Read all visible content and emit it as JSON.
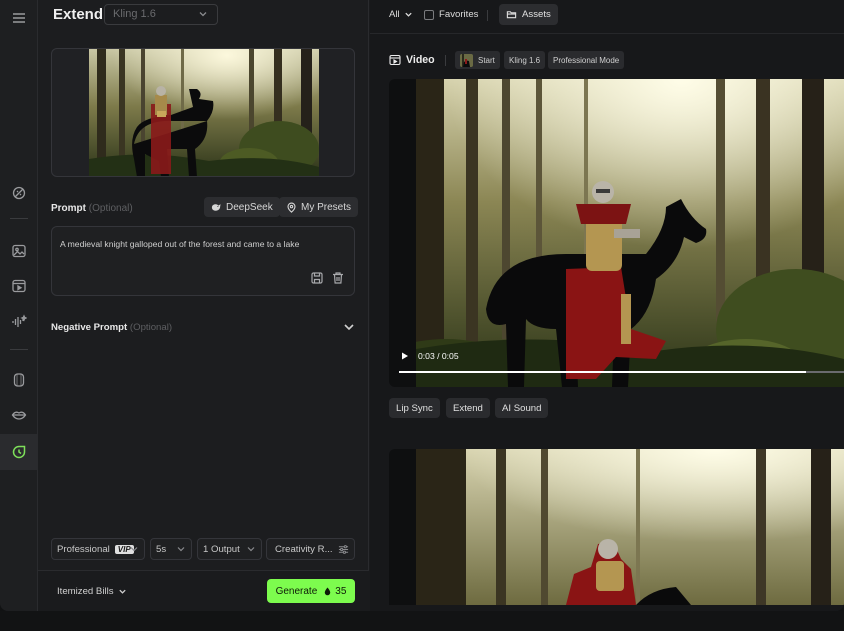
{
  "panel": {
    "title": "Extend",
    "model_placeholder": "Kling 1.6",
    "prompt_label": "Prompt",
    "optional_label": "(Optional)",
    "deepseek_label": "DeepSeek",
    "presets_label": "My Presets",
    "prompt_text": "A medieval knight galloped out of the forest and came to a lake",
    "negative_label": "Negative Prompt",
    "options": {
      "mode": "Professional",
      "mode_badge": "VIP",
      "duration": "5s",
      "outputs": "1 Output",
      "creativity": "Creativity R..."
    },
    "bills_label": "Itemized Bills",
    "generate_label": "Generate",
    "generate_cost": "35"
  },
  "toolbar": {
    "filter_all": "All",
    "favorites": "Favorites",
    "assets": "Assets"
  },
  "video": {
    "heading": "Video",
    "tags": [
      "Start",
      "Kling 1.6",
      "Professional Mode"
    ],
    "time": "0:03 / 0:05",
    "progress": 0.915,
    "actions": [
      "Lip Sync",
      "Extend",
      "AI Sound"
    ]
  },
  "icons": [
    "menu-icon",
    "effects-icon",
    "image-icon",
    "video-icon",
    "audio-icon",
    "avatar-icon",
    "lips-icon",
    "extend-icon"
  ],
  "colors": {
    "accent": "#7dfc4e",
    "background": "#1a1b1d"
  }
}
